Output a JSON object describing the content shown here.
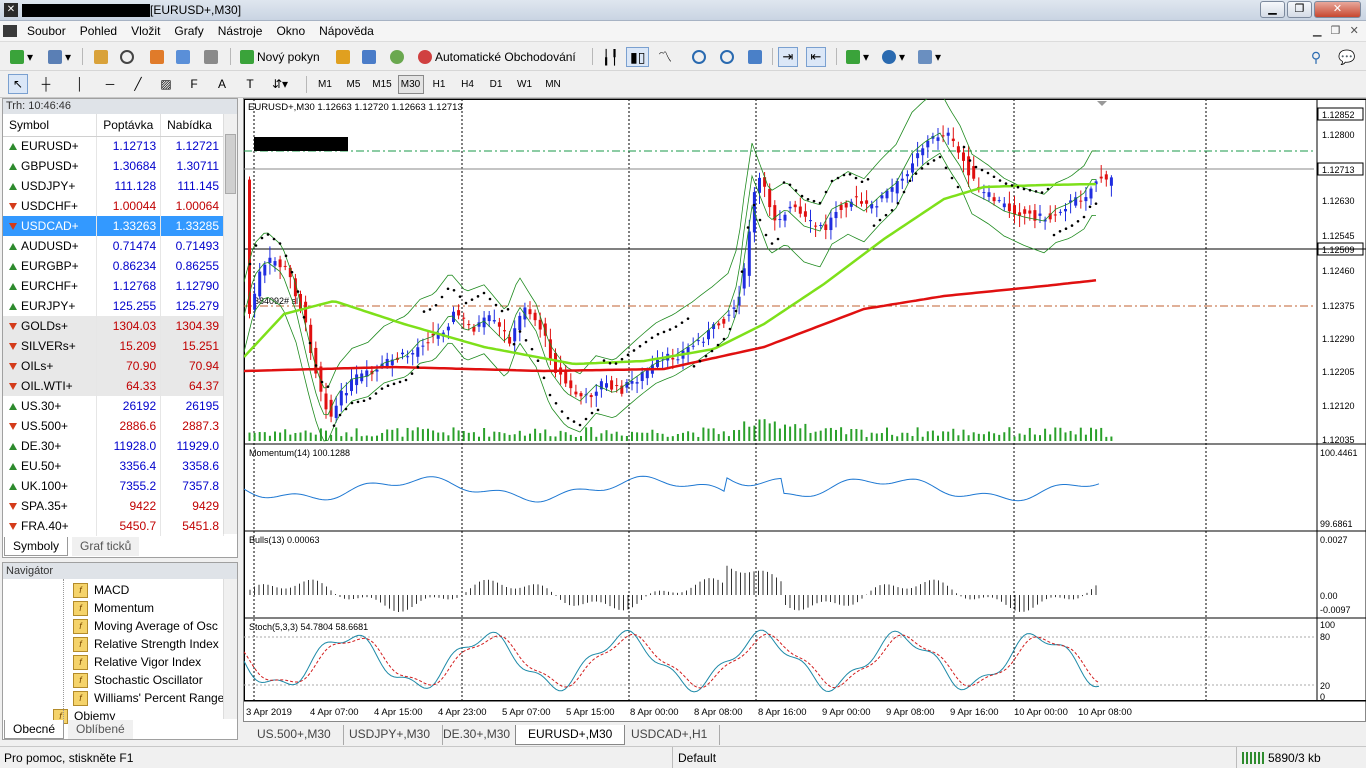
{
  "window": {
    "title": "[EURUSD+,M30]"
  },
  "menu": [
    "Soubor",
    "Pohled",
    "Vložit",
    "Grafy",
    "Nástroje",
    "Okno",
    "Nápověda"
  ],
  "toolbar": {
    "new_order": "Nový pokyn",
    "auto_trading": "Automatické Obchodování"
  },
  "timeframes": [
    "M1",
    "M5",
    "M15",
    "M30",
    "H1",
    "H4",
    "D1",
    "W1",
    "MN"
  ],
  "active_timeframe": "M30",
  "market_watch": {
    "time_label": "Trh: 10:46:46",
    "columns": [
      "Symbol",
      "Poptávka",
      "Nabídka"
    ],
    "rows": [
      {
        "symbol": "EURUSD+",
        "bid": "1.12713",
        "ask": "1.12721",
        "dir": "up"
      },
      {
        "symbol": "GBPUSD+",
        "bid": "1.30684",
        "ask": "1.30711",
        "dir": "up"
      },
      {
        "symbol": "USDJPY+",
        "bid": "111.128",
        "ask": "111.145",
        "dir": "up"
      },
      {
        "symbol": "USDCHF+",
        "bid": "1.00044",
        "ask": "1.00064",
        "dir": "dn"
      },
      {
        "symbol": "USDCAD+",
        "bid": "1.33263",
        "ask": "1.33285",
        "dir": "dn",
        "selected": true
      },
      {
        "symbol": "AUDUSD+",
        "bid": "0.71474",
        "ask": "0.71493",
        "dir": "up"
      },
      {
        "symbol": "EURGBP+",
        "bid": "0.86234",
        "ask": "0.86255",
        "dir": "up"
      },
      {
        "symbol": "EURCHF+",
        "bid": "1.12768",
        "ask": "1.12790",
        "dir": "up"
      },
      {
        "symbol": "EURJPY+",
        "bid": "125.255",
        "ask": "125.279",
        "dir": "up"
      },
      {
        "symbol": "GOLDs+",
        "bid": "1304.03",
        "ask": "1304.39",
        "dir": "dn",
        "gray": true
      },
      {
        "symbol": "SILVERs+",
        "bid": "15.209",
        "ask": "15.251",
        "dir": "dn",
        "gray": true
      },
      {
        "symbol": "OILs+",
        "bid": "70.90",
        "ask": "70.94",
        "dir": "dn",
        "gray": true
      },
      {
        "symbol": "OIL.WTI+",
        "bid": "64.33",
        "ask": "64.37",
        "dir": "dn",
        "gray": true
      },
      {
        "symbol": "US.30+",
        "bid": "26192",
        "ask": "26195",
        "dir": "up"
      },
      {
        "symbol": "US.500+",
        "bid": "2886.6",
        "ask": "2887.3",
        "dir": "dn"
      },
      {
        "symbol": "DE.30+",
        "bid": "11928.0",
        "ask": "11929.0",
        "dir": "up"
      },
      {
        "symbol": "EU.50+",
        "bid": "3356.4",
        "ask": "3358.6",
        "dir": "up"
      },
      {
        "symbol": "UK.100+",
        "bid": "7355.2",
        "ask": "7357.8",
        "dir": "up"
      },
      {
        "symbol": "SPA.35+",
        "bid": "9422",
        "ask": "9429",
        "dir": "dn"
      },
      {
        "symbol": "FRA.40+",
        "bid": "5450.7",
        "ask": "5451.8",
        "dir": "dn"
      }
    ],
    "tabs": [
      "Symboly",
      "Graf ticků"
    ]
  },
  "navigator": {
    "title": "Navigátor",
    "items": [
      "MACD",
      "Momentum",
      "Moving Average of Osc",
      "Relative Strength Index",
      "Relative Vigor Index",
      "Stochastic Oscillator",
      "Williams' Percent Range",
      "Objemy"
    ],
    "tabs": [
      "Obecné",
      "Oblíbené"
    ]
  },
  "chart": {
    "header": "EURUSD+,M30  1.12663 1.12720 1.12663 1.12713",
    "order_label": "384092# sl",
    "price_scale": [
      "1.12852",
      "1.12800",
      "1.12713",
      "1.12630",
      "1.12545",
      "1.12509",
      "1.12460",
      "1.12375",
      "1.12290",
      "1.12205",
      "1.12120",
      "1.12035"
    ],
    "current_price": "1.12713",
    "marker_price": "1.12509",
    "time_labels": [
      "3 Apr 2019",
      "4 Apr 07:00",
      "4 Apr 15:00",
      "4 Apr 23:00",
      "5 Apr 07:00",
      "5 Apr 15:00",
      "8 Apr 00:00",
      "8 Apr 08:00",
      "8 Apr 16:00",
      "9 Apr 00:00",
      "9 Apr 08:00",
      "9 Apr 16:00",
      "10 Apr 00:00",
      "10 Apr 08:00"
    ],
    "momentum": {
      "label": "Momentum(14) 100.1288",
      "top": "100.4461",
      "bottom": "99.6861"
    },
    "bulls": {
      "label": "Bulls(13) 0.00063",
      "top": "0.0027",
      "mid": "0.00",
      "bottom": "-0.0097"
    },
    "stoch": {
      "label": "Stoch(5,3,3) 54.7804 58.6681",
      "levels": [
        "100",
        "80",
        "20",
        "0"
      ]
    }
  },
  "chart_tabs": [
    "US.500+,M30",
    "USDJPY+,M30",
    "DE.30+,M30",
    "EURUSD+,M30",
    "USDCAD+,H1"
  ],
  "active_chart_tab": "EURUSD+,M30",
  "status": {
    "help": "Pro pomoc, stiskněte F1",
    "profile": "Default",
    "traffic": "5890/3 kb"
  },
  "colors": {
    "bull": "#1f2de0",
    "bear": "#e01010",
    "ma_fast": "#7ee01a",
    "ma_slow": "#e01010",
    "bands": "#1e8a1e",
    "momentum": "#1e78d2",
    "stoch_main": "#1e8aa8",
    "stoch_signal": "#d21e1e",
    "selection": "#3399ff"
  }
}
